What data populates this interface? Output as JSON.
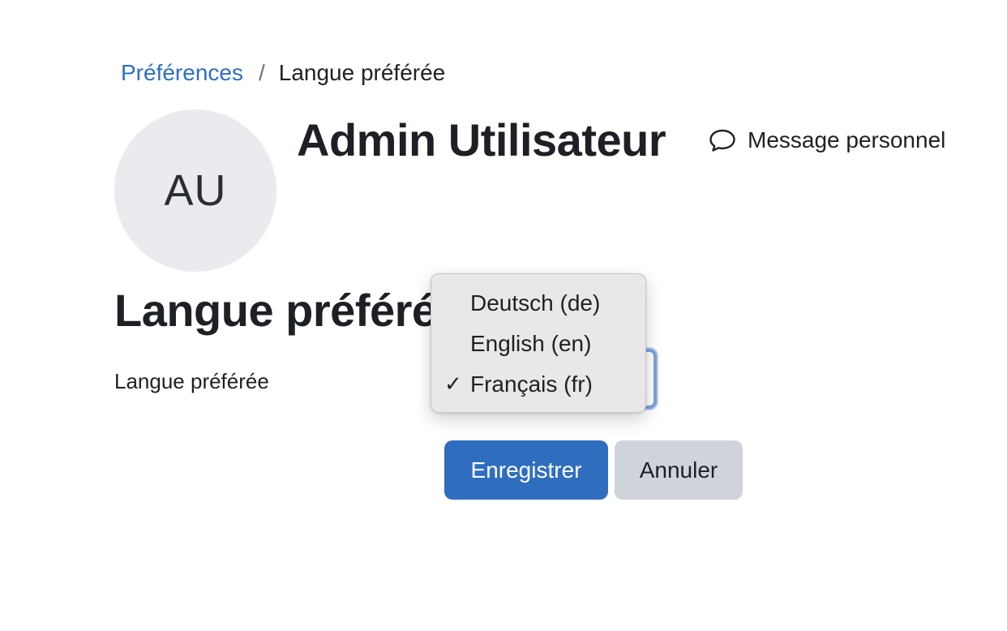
{
  "breadcrumb": {
    "parent_label": "Préférences",
    "separator": "/",
    "current_label": "Langue préférée"
  },
  "profile": {
    "avatar_initials": "AU",
    "user_name": "Admin Utilisateur",
    "message_label": "Message personnel",
    "message_icon": "speech-bubble-icon"
  },
  "section": {
    "title": "Langue préférée"
  },
  "form": {
    "language_label": "Langue préférée",
    "language_select": {
      "selected_value": "Français (fr)",
      "options": [
        {
          "label": "Deutsch (de)",
          "selected": false
        },
        {
          "label": "English (en)",
          "selected": false
        },
        {
          "label": "Français (fr)",
          "selected": true
        }
      ],
      "check_mark": "✓"
    },
    "save_label": "Enregistrer",
    "cancel_label": "Annuler"
  },
  "colors": {
    "link": "#2f6fbf",
    "primary_button": "#2f6ebf",
    "secondary_button": "#ced4da",
    "avatar_bg": "#e9ebef",
    "focus_ring": "#7aa3d8"
  }
}
